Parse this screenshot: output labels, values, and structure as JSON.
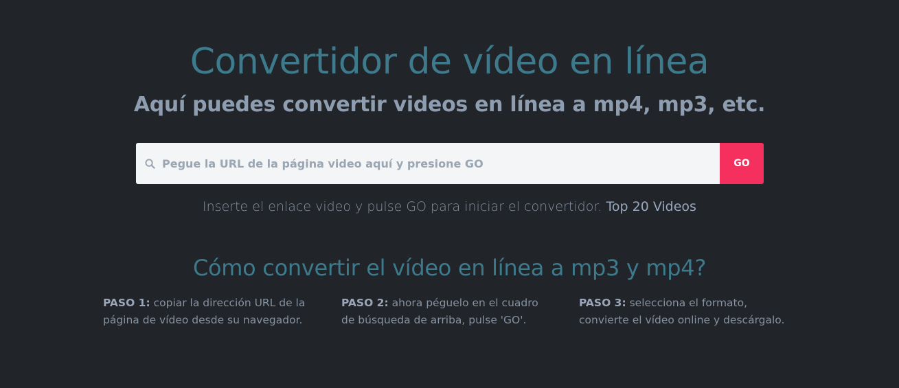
{
  "hero": {
    "title": "Convertidor de vídeo en línea",
    "subtitle": "Aquí puedes convertir videos en línea a mp4, mp3, etc."
  },
  "search": {
    "icon": "search-icon",
    "placeholder": "Pegue la URL de la página video aquí y presione GO",
    "value": "",
    "go_label": "GO"
  },
  "helper": {
    "text": "Inserte el enlace video y pulse GO para iniciar el convertidor.",
    "link_label": "Top 20 Videos"
  },
  "howto": {
    "title": "Cómo convertir el vídeo en línea a mp3 y mp4?",
    "steps": [
      {
        "label": "PASO 1:",
        "text": "copiar la dirección URL de la página de vídeo desde su navegador."
      },
      {
        "label": "PASO 2:",
        "text": "ahora péguelo en el cuadro de búsqueda de arriba, pulse 'GO'."
      },
      {
        "label": "PASO 3:",
        "text": "selecciona el formato, convierte el vídeo online y descárgalo."
      }
    ]
  },
  "colors": {
    "background": "#212429",
    "accent_title": "#3d7a8c",
    "go_button": "#f5305e",
    "input_bg": "#f3f5f7"
  }
}
